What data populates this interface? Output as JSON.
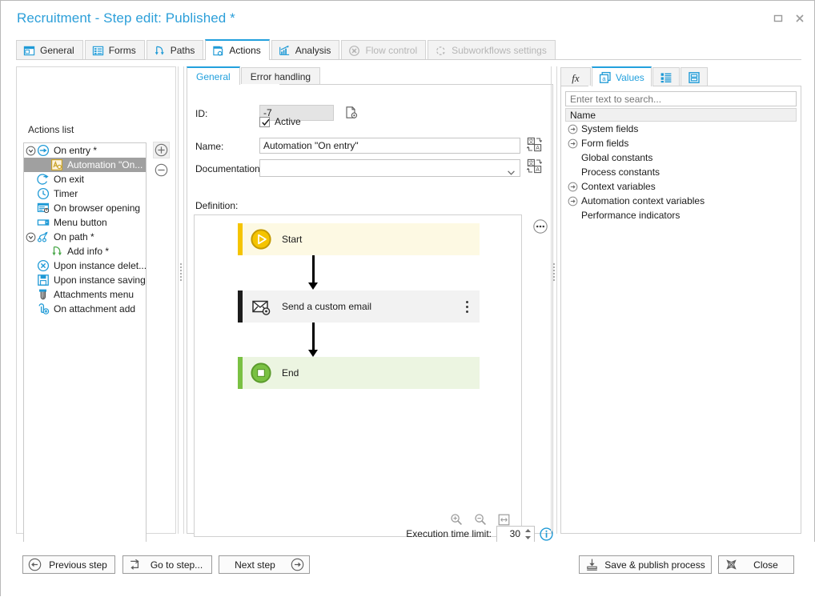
{
  "window": {
    "title": "Recruitment - Step edit: Published *",
    "controls": [
      {
        "name": "restore-window-button",
        "glyph": "restore"
      },
      {
        "name": "close-window-button",
        "glyph": "close"
      }
    ]
  },
  "main_tabs": [
    {
      "label": "General",
      "icon": "window-icon",
      "state": "normal"
    },
    {
      "label": "Forms",
      "icon": "form-list-icon",
      "state": "normal"
    },
    {
      "label": "Paths",
      "icon": "path-arrow-icon",
      "state": "normal"
    },
    {
      "label": "Actions",
      "icon": "actions-icon",
      "state": "active"
    },
    {
      "label": "Analysis",
      "icon": "chart-icon",
      "state": "normal"
    },
    {
      "label": "Flow control",
      "icon": "flow-control-icon",
      "state": "disabled"
    },
    {
      "label": "Subworkflows settings",
      "icon": "subworkflow-icon",
      "state": "disabled"
    }
  ],
  "actions_panel": {
    "group_title": "Actions list",
    "add_button_label": "+",
    "remove_button_label": "-",
    "items": [
      {
        "label": "On entry *",
        "icon": "on-entry-icon",
        "expander": "collapse",
        "indent": 0,
        "selected": false
      },
      {
        "label": "Automation \"On...",
        "icon": "automation-icon",
        "expander": "none",
        "indent": 1,
        "selected": true
      },
      {
        "label": "On exit",
        "icon": "on-exit-icon",
        "expander": "none",
        "indent": 0,
        "selected": false
      },
      {
        "label": "Timer",
        "icon": "timer-icon",
        "expander": "none",
        "indent": 0,
        "selected": false
      },
      {
        "label": "On browser opening",
        "icon": "browser-icon",
        "expander": "none",
        "indent": 0,
        "selected": false
      },
      {
        "label": "Menu button",
        "icon": "menu-button-icon",
        "expander": "none",
        "indent": 0,
        "selected": false
      },
      {
        "label": "On path *",
        "icon": "on-path-icon",
        "expander": "collapse",
        "indent": 0,
        "selected": false
      },
      {
        "label": "Add info *",
        "icon": "add-info-icon",
        "expander": "none",
        "indent": 1,
        "selected": false
      },
      {
        "label": "Upon instance delet...",
        "icon": "instance-delete-icon",
        "expander": "none",
        "indent": 0,
        "selected": false
      },
      {
        "label": "Upon instance saving",
        "icon": "instance-save-icon",
        "expander": "none",
        "indent": 0,
        "selected": false
      },
      {
        "label": "Attachments menu",
        "icon": "attachments-menu-icon",
        "expander": "none",
        "indent": 0,
        "selected": false
      },
      {
        "label": "On attachment add",
        "icon": "attachment-add-icon",
        "expander": "none",
        "indent": 0,
        "selected": false
      }
    ]
  },
  "center": {
    "sub_tabs": [
      {
        "label": "General",
        "state": "active"
      },
      {
        "label": "Error handling",
        "state": "normal"
      }
    ],
    "fields": {
      "id_label": "ID:",
      "id_value": "-7",
      "active_label": "Active",
      "active_checked": true,
      "name_label": "Name:",
      "name_value": "Automation \"On entry\"",
      "documentation_label": "Documentation:",
      "documentation_value": "",
      "definition_label": "Definition:"
    },
    "execution": {
      "label": "Execution time limit:",
      "value": "30"
    }
  },
  "diagram": {
    "nodes": [
      {
        "label": "Start",
        "icon": "play-icon",
        "accent": "#f5c400",
        "fill": "#fdf9e3",
        "type": "start"
      },
      {
        "label": "Send a custom email",
        "icon": "email-settings-icon",
        "accent": "#1c1c1c",
        "fill": "#f2f2f2",
        "type": "action"
      },
      {
        "label": "End",
        "icon": "stop-icon",
        "accent": "#7ac143",
        "fill": "#ecf5e1",
        "type": "end"
      }
    ],
    "tools": [
      {
        "name": "zoom-in-icon",
        "label": "Zoom in"
      },
      {
        "name": "zoom-out-icon",
        "label": "Zoom out"
      },
      {
        "name": "fit-to-width-icon",
        "label": "Fit"
      }
    ],
    "menu_button": "more-options-icon"
  },
  "right_panel": {
    "tabs": [
      {
        "label": "",
        "icon": "function-fx-icon",
        "state": "normal"
      },
      {
        "label": "Values",
        "icon": "values-icon",
        "state": "active"
      },
      {
        "label": "",
        "icon": "list-icon",
        "state": "normal"
      },
      {
        "label": "",
        "icon": "document-icon",
        "state": "normal"
      }
    ],
    "search_placeholder": "Enter text to search...",
    "column_header": "Name",
    "tree": [
      {
        "label": "System fields",
        "expandable": true
      },
      {
        "label": "Form fields",
        "expandable": true
      },
      {
        "label": "Global constants",
        "expandable": false
      },
      {
        "label": "Process constants",
        "expandable": false
      },
      {
        "label": "Context variables",
        "expandable": true
      },
      {
        "label": "Automation context variables",
        "expandable": true
      },
      {
        "label": "Performance indicators",
        "expandable": false
      }
    ]
  },
  "footer": {
    "previous_step": "Previous step",
    "go_to_step": "Go to step...",
    "next_step": "Next step",
    "save_publish": "Save & publish process",
    "close": "Close"
  },
  "colors": {
    "accent": "#22a0dd",
    "title": "#2c9fd9",
    "start_accent": "#f5c400",
    "end_accent": "#7ac143",
    "selection": "#a0a0a0"
  }
}
